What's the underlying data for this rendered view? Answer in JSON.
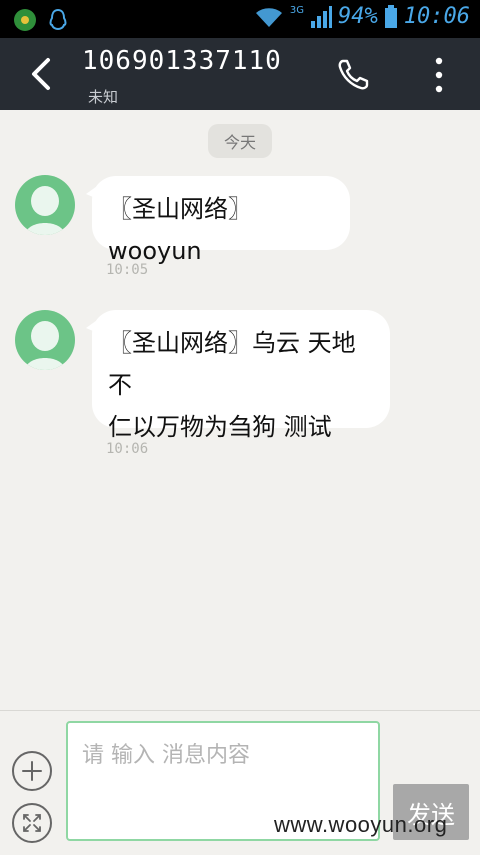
{
  "status_bar": {
    "network": "3G",
    "battery": "94%",
    "time": "10:06"
  },
  "header": {
    "contact_number": "106901337110",
    "contact_label": "未知",
    "back_icon": "chevron-left-icon",
    "call_icon": "phone-icon",
    "more_icon": "more-vertical-icon"
  },
  "chat": {
    "date_label": "今天",
    "messages": [
      {
        "text_line1": "〖圣山网络〗wooyun",
        "text_line2": "",
        "time": "10:05"
      },
      {
        "text_line1": "〖圣山网络〗乌云 天地不",
        "text_line2": "仁以万物为刍狗 测试",
        "time": "10:06"
      }
    ]
  },
  "composer": {
    "placeholder": "请 输入 消息内容",
    "send_label": "发送",
    "add_icon": "plus-icon",
    "expand_icon": "expand-icon"
  },
  "watermark": "www.wooyun.org",
  "colors": {
    "header_bg": "#272c33",
    "avatar_bg": "#6cc487",
    "input_border": "#8fd7a3",
    "send_bg": "#a8a8a8"
  }
}
